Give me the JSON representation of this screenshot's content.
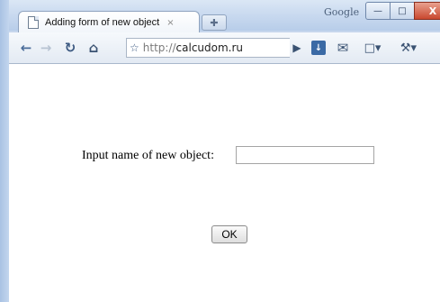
{
  "window": {
    "profile_label": "Google",
    "controls": {
      "minimize": "—",
      "maximize": "□",
      "close": "X"
    }
  },
  "tab": {
    "title": "Adding form of new object",
    "close_glyph": "×",
    "new_tab_glyph": "✚"
  },
  "toolbar": {
    "url_scheme": "http://",
    "url_host": "calcudom.ru",
    "icons": [
      "back-icon",
      "forward-icon",
      "reload-icon",
      "home-icon",
      "star-icon",
      "play-icon",
      "download-icon",
      "mail-icon",
      "page-menu-icon",
      "wrench-icon"
    ]
  },
  "form": {
    "label": "Input name of new object:",
    "input_value": "",
    "ok_label": "OK"
  }
}
